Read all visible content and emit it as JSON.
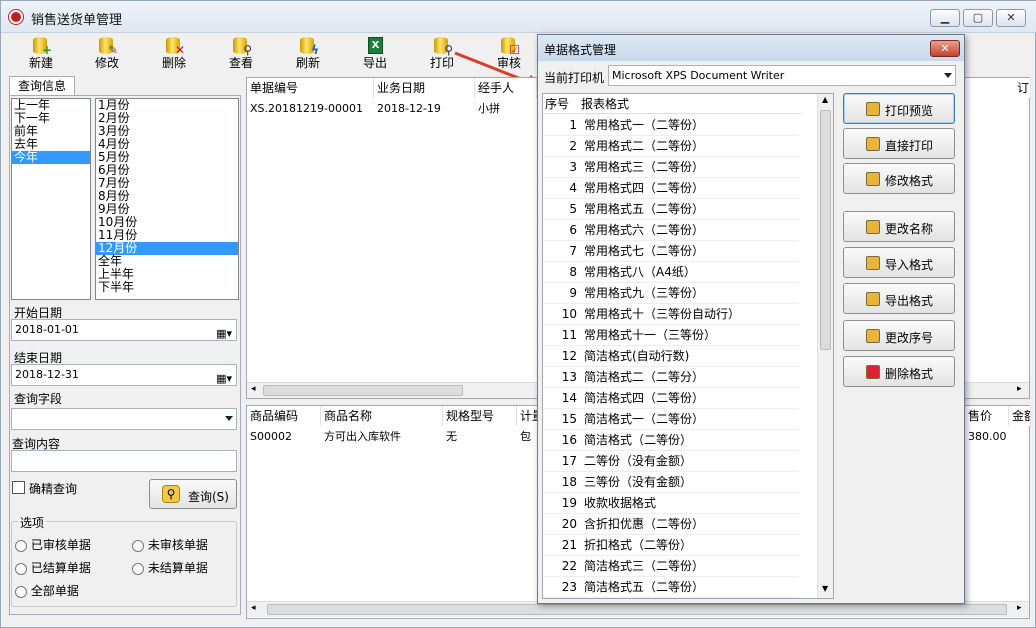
{
  "window": {
    "title": "销售送货单管理"
  },
  "toolbar": [
    {
      "label": "新建",
      "icon": "db-add-icon"
    },
    {
      "label": "修改",
      "icon": "db-edit-icon"
    },
    {
      "label": "删除",
      "icon": "db-delete-icon"
    },
    {
      "label": "查看",
      "icon": "db-view-icon"
    },
    {
      "label": "刷新",
      "icon": "db-refresh-icon"
    },
    {
      "label": "导出",
      "icon": "excel-export-icon"
    },
    {
      "label": "打印",
      "icon": "print-magnifier-icon"
    },
    {
      "label": "审核",
      "icon": "approve-icon"
    }
  ],
  "left": {
    "tab": "查询信息",
    "years": [
      "上一年",
      "下一年",
      "前年",
      "去年",
      "今年"
    ],
    "year_selected": 4,
    "months": [
      "1月份",
      "2月份",
      "3月份",
      "4月份",
      "5月份",
      "6月份",
      "7月份",
      "8月份",
      "9月份",
      "10月份",
      "11月份",
      "12月份",
      "全年",
      "上半年",
      "下半年"
    ],
    "month_selected": 11,
    "start_label": "开始日期",
    "start_value": "2018-01-01",
    "end_label": "结束日期",
    "end_value": "2018-12-31",
    "field_label": "查询字段",
    "field_value": "",
    "content_label": "查询内容",
    "content_value": "",
    "exact_label": "确精查询",
    "query_button": "查询(S)",
    "options_label": "选项",
    "options": [
      "已审核单据",
      "未审核单据",
      "已结算单据",
      "未结算单据",
      "全部单据"
    ]
  },
  "top_grid": {
    "columns": [
      "单据编号",
      "业务日期",
      "经手人",
      "",
      "订"
    ],
    "rows": [
      [
        "XS.20181219-00001",
        "2018-12-19",
        "小拼"
      ]
    ]
  },
  "bottom_grid": {
    "columns": [
      "商品编码",
      "商品名称",
      "规格型号",
      "计量",
      "售价",
      "金额"
    ],
    "rows": [
      [
        "S00002",
        "方可出入库软件",
        "无",
        "包",
        "380.00"
      ]
    ]
  },
  "dialog": {
    "title": "单据格式管理",
    "printer_label": "当前打印机",
    "printer_value": "Microsoft XPS Document Writer",
    "col_no": "序号",
    "col_name": "报表格式",
    "rows": [
      [
        "1",
        "常用格式一（二等份）"
      ],
      [
        "2",
        "常用格式二（二等份）"
      ],
      [
        "3",
        "常用格式三（二等份）"
      ],
      [
        "4",
        "常用格式四（二等份）"
      ],
      [
        "5",
        "常用格式五（二等份）"
      ],
      [
        "6",
        "常用格式六（二等份）"
      ],
      [
        "7",
        "常用格式七（二等份）"
      ],
      [
        "8",
        "常用格式八（A4纸）"
      ],
      [
        "9",
        "常用格式九（三等份）"
      ],
      [
        "10",
        "常用格式十（三等份自动行）"
      ],
      [
        "11",
        "常用格式十一（三等份）"
      ],
      [
        "12",
        "简洁格式(自动行数)"
      ],
      [
        "13",
        "简洁格式二（二等分）"
      ],
      [
        "14",
        "简洁格式四（二等份）"
      ],
      [
        "15",
        "简洁格式一（二等份）"
      ],
      [
        "16",
        "简洁格式（二等份）"
      ],
      [
        "17",
        "二等份（没有金额）"
      ],
      [
        "18",
        "三等份（没有金额）"
      ],
      [
        "19",
        "收款收据格式"
      ],
      [
        "20",
        "含折扣优惠（二等份）"
      ],
      [
        "21",
        "折扣格式（二等份）"
      ],
      [
        "22",
        "简洁格式三（二等份）"
      ],
      [
        "23",
        "简洁格式五（二等份）"
      ]
    ],
    "buttons": [
      "打印预览",
      "直接打印",
      "修改格式",
      "更改名称",
      "导入格式",
      "导出格式",
      "更改序号",
      "删除格式"
    ]
  }
}
